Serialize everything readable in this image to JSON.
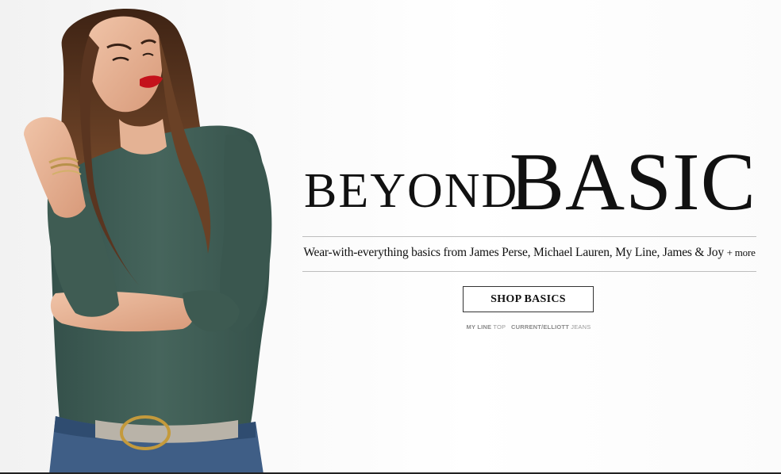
{
  "headline": {
    "word1": "BEYOND",
    "word2": "BASIC"
  },
  "tagline": {
    "text": "Wear-with-everything basics from James Perse, Michael Lauren, My Line, James & Joy",
    "plus": "+ more"
  },
  "cta": {
    "label": "SHOP BASICS"
  },
  "credits": {
    "brand1": "MY LINE",
    "item1": "TOP",
    "brand2": "CURRENT/ELLIOTT",
    "item2": "JEANS"
  },
  "image": {
    "subject": "model-photo"
  },
  "colors": {
    "top": "#3d5a50",
    "jeans": "#3f5e86",
    "hair": "#5a3520",
    "lips": "#c4121b",
    "text": "#111111"
  }
}
